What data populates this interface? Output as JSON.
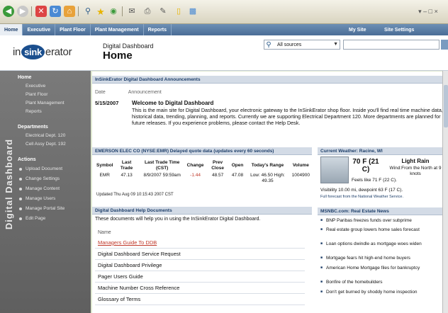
{
  "browser": {
    "icons": [
      "back-icon",
      "forward-icon",
      "stop-icon",
      "refresh-icon",
      "home-icon",
      "search-icon",
      "favorites-icon",
      "history-icon",
      "mail-icon",
      "print-icon",
      "edit-icon",
      "folder-icon",
      "messenger-icon"
    ],
    "window_controls_text": "▾ – □ ×"
  },
  "nav": {
    "items": [
      "Home",
      "Executive",
      "Plant Floor",
      "Plant Management",
      "Reports"
    ],
    "right": [
      "My Site",
      "Site Settings"
    ]
  },
  "header": {
    "logo_pre": "in",
    "logo_mid": "sink",
    "logo_post": "erator",
    "subtitle": "Digital Dashboard",
    "title": "Home",
    "scope": "All sources"
  },
  "sidebar": {
    "vertical_title": "Digital Dashboard",
    "groups": [
      {
        "label": "Home",
        "links": [
          "Executive",
          "Plant Floor",
          "Plant Management",
          "Reports"
        ]
      },
      {
        "label": "Departments",
        "links": [
          "Electrical Dept. 120",
          "Cell Assy Dept. 192"
        ]
      },
      {
        "label": "Actions",
        "links": [
          "Upload Document",
          "Change Settings",
          "Manage Content",
          "Manage Users",
          "Manage Portal Site",
          "Edit Page"
        ]
      }
    ]
  },
  "announcements": {
    "header": "InSinkErator Digital Dashboard Announcements",
    "col_date": "Date",
    "col_announcement": "Announcement",
    "date": "5/15/2007",
    "title": "Welcome to Digital Dashboard",
    "body": "This is the main site for Digital Dashboard, your electronic gateway to the InSinkErator shop floor. Inside you'll find real time machine data, historical data, trending, planning, and reports. Currently we are supporting Electrical Department 120. More departments are planned for future releases. If you experience problems, please contact the Help Desk."
  },
  "stock": {
    "header": "EMERSON ELEC CO (NYSE:EMR) Delayed quote data (updates every 60 seconds)",
    "columns": [
      "Symbol",
      "Last Trade",
      "Last Trade Time (CST)",
      "Change",
      "Prev Close",
      "Open",
      "Today's Range",
      "Volume"
    ],
    "row": [
      "EMR",
      "47.13",
      "8/9/2007 59:59am",
      "-1.44",
      "48.57",
      "47.08",
      "Low: 46.50 High: 49.35",
      "1004900"
    ],
    "updated": "Updated Thu Aug 09 10:15:43 2007 CST"
  },
  "weather": {
    "header": "Current Weather: Racine, WI",
    "temp": "70 F (21 C)",
    "condition": "Light Rain",
    "wind": "Wind:From the North at 9 knots",
    "feels": "Feels like 71 F (22 C).",
    "visibility": "Visibility 10.00 mi, dewpoint 63 F (17 C).",
    "source": "Full forecast from the National Weather Service."
  },
  "docs": {
    "header": "Digital Dashboard Help Documents",
    "description": "These documents will help you in using the InSinkErator Digital Dashboard.",
    "col_name": "Name",
    "items": [
      "Managers Guide To DDB",
      "Digital Dashboard Service Request",
      "Digital Dashboard Privilege",
      "Pager Users Guide",
      "Machine Number Cross Reference",
      "Glossary of Terms"
    ]
  },
  "news": {
    "header": "MSNBC.com: Real Estate News",
    "items": [
      "BNP Paribas freezes funds over subprime",
      "Real estate group lowers home sales forecast",
      "Loan options dwindle as mortgage woes widen",
      "Mortgage fears hit high-end home buyers",
      "American Home Mortgage files for bankruptcy",
      "Bonfire of the homebuilders",
      "Don't get burned by shoddy home inspection"
    ]
  }
}
